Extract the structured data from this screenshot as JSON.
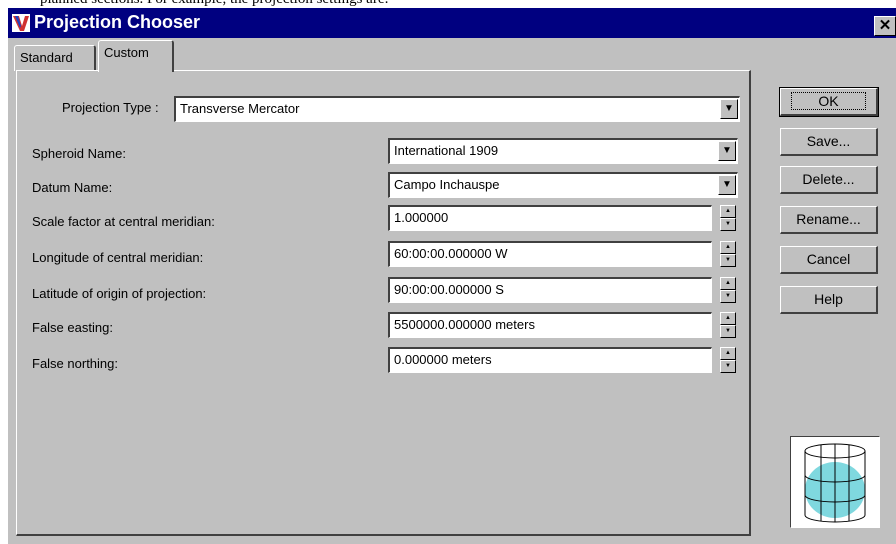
{
  "window": {
    "title": "Projection Chooser",
    "close_glyph": "✕"
  },
  "top_fragment": "planned              sections. For example, the projection settings are:",
  "tabs": [
    {
      "label": "Standard",
      "active": false
    },
    {
      "label": "Custom",
      "active": true
    }
  ],
  "projection_type": {
    "label": "Projection Type :",
    "value": "Transverse Mercator"
  },
  "fields": [
    {
      "label": "Spheroid Name:",
      "value": "International 1909",
      "control": "dropdown"
    },
    {
      "label": "Datum Name:",
      "value": "Campo Inchauspe",
      "control": "dropdown"
    },
    {
      "label": "Scale factor at central meridian:",
      "value": "1.000000",
      "control": "spinner"
    },
    {
      "label": "Longitude of central meridian:",
      "value": "60:00:00.000000 W",
      "control": "spinner"
    },
    {
      "label": "Latitude of origin of projection:",
      "value": "90:00:00.000000 S",
      "control": "spinner"
    },
    {
      "label": "False easting:",
      "value": "5500000.000000 meters",
      "control": "spinner"
    },
    {
      "label": "False northing:",
      "value": "0.000000 meters",
      "control": "spinner"
    }
  ],
  "buttons": {
    "ok": "OK",
    "save": "Save...",
    "delete": "Delete...",
    "rename": "Rename...",
    "cancel": "Cancel",
    "help": "Help"
  },
  "icons": {
    "app": "app-logo-icon",
    "preview": "cylinder-projection-icon",
    "dropdown": "chevron-down-icon",
    "spin_up": "spin-up-icon",
    "spin_down": "spin-down-icon"
  },
  "colors": {
    "titlebar": "#000080",
    "face": "#c0c0c0",
    "globe_fill": "#7fd8df"
  }
}
